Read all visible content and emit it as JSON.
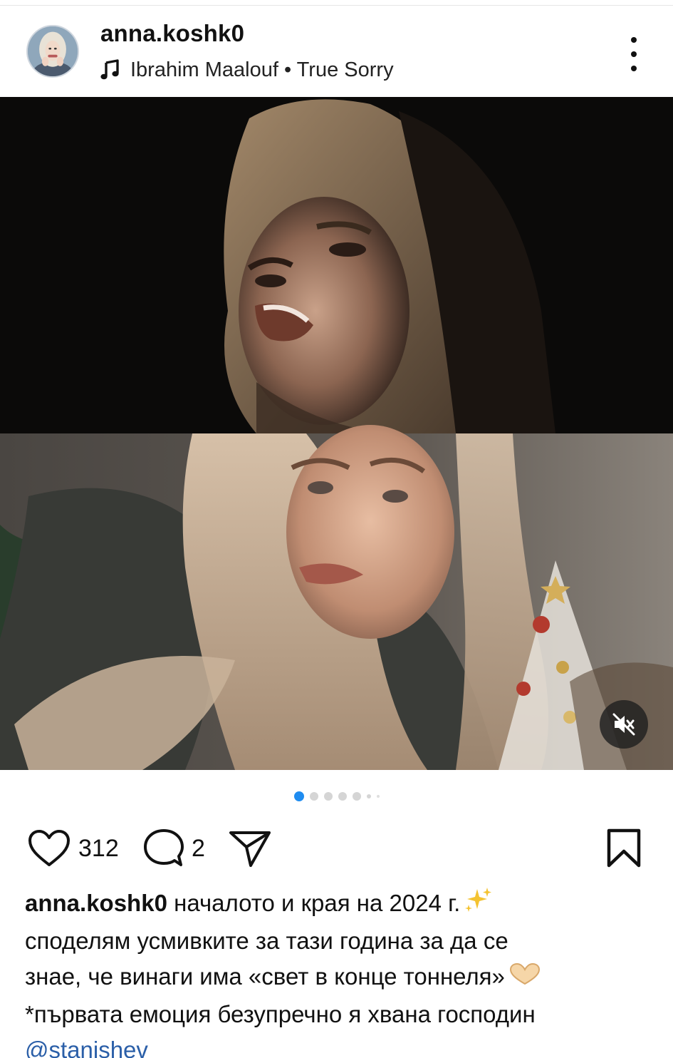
{
  "post": {
    "username": "anna.koshk0",
    "music": "Ibrahim Maalouf • True Sorry",
    "media": {
      "slide_count": 6,
      "active_slide": 1,
      "mute_icon": "speaker-muted-icon"
    },
    "stats": {
      "likes": "312",
      "comments": "2"
    },
    "caption": {
      "user": "anna.koshk0",
      "line1": " началото и края на 2024 г.",
      "line2": "споделям усмивките за тази година за да се",
      "line3": "знае, че винаги има «свет в конце тоннеля»",
      "line4": "*първата емоция безупречно я хвана господин",
      "mention": "@stanishev"
    }
  },
  "colors": {
    "accent_dot": "#1f8cf0",
    "mention": "#2b5fa8",
    "text": "#111111"
  }
}
